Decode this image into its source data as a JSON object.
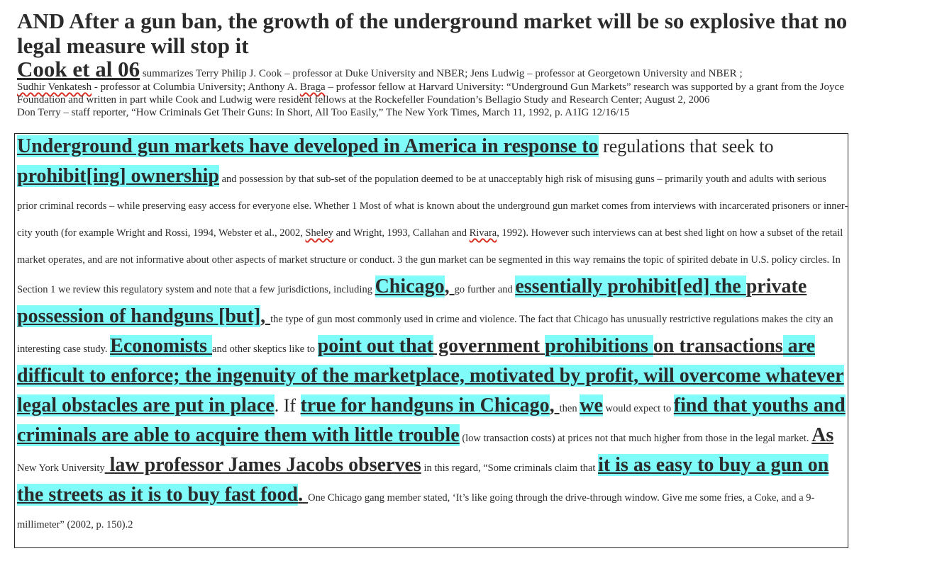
{
  "tag": "AND After a gun ban, the growth of the underground market will be so explosive that no legal measure will stop it",
  "cite": {
    "name": "Cook et al 06",
    "text1": " summarizes Terry Philip J. Cook – professor at Duke University and NBER; Jens Ludwig – professor at Georgetown University and NBER ; ",
    "sudhir": "Sudhir Venkatesh",
    "text2": " - professor at Columbia University; Anthony A. ",
    "braga": "Braga",
    "text3": " – professor fellow at Harvard University: “Underground Gun Markets” research was supported by a grant from the Joyce Foundation and written in part while Cook and Ludwig were resident fellows at the Rockefeller Foundation’s Bellagio Study and Research Center; August 2, 2006",
    "line4": "Don Terry – staff reporter, “How Criminals Get Their Guns: In Short, All Too Easily,” The New York Times, March 11, 1992, p. A1IG 12/16/15"
  },
  "card": {
    "s1": "Underground gun markets have developed in America in response to",
    "s2": " regulations that seek to ",
    "s3": "prohibit[ing] ownership",
    "s4": " and possession by that sub-set of the population deemed to be at unacceptably high risk of misusing guns – primarily youth and adults with serious prior criminal records – while preserving easy access for everyone else. Whether 1 Most of what is known about the underground gun market comes from interviews with incarcerated prisoners or inner-city youth (for example Wright and Rossi, 1994, Webster et al., 2002, ",
    "sheley": "Sheley",
    "s5": " and Wright, 1993, Callahan and ",
    "rivara": "Rivara",
    "s6": ", 1992). However such interviews can at best shed light on how a subset of the retail market operates, and are not informative about other aspects of market structure or conduct. 3 the gun market can be segmented in this way remains the topic of spirited debate in U.S. policy circles. In Section 1 we review this regulatory system and note that a few jurisdictions, including ",
    "s7": "Chicago",
    "s8": ", ",
    "s9": "go further and ",
    "s10": "essentially prohibit[ed] the ",
    "s11": "private",
    "s12": " possession of handguns [but]",
    "s13": ", ",
    "s14": "the type of gun most commonly used in crime and violence. The fact that Chicago has unusually restrictive regulations makes the city an interesting case study. ",
    "s15": "Economists ",
    "s16": "and other skeptics like to ",
    "s17": "point out that",
    "s18": " government ",
    "s19": "prohibitions ",
    "s20": "on transactions",
    "s21": " are difficult to enforce; the ingenuity ",
    "s22": "of the marketplace, motivated by profit, will overcome whatever legal obstacles are put in place",
    "s23": ". If ",
    "s24": "true for handguns in Chicago",
    "s25": ", ",
    "s26": "then ",
    "s27": "we",
    "s28": " would expect to ",
    "s29": "find that youths and criminals are able to acquire them with little trouble",
    "s30": " (low transaction costs) at prices not that much higher from those in the legal market. ",
    "s31": "As ",
    "s32": "New York University",
    "s33": " law professor James Jacobs observes",
    "s34": " in this regard, “Some criminals claim that ",
    "s35": "it is as easy to buy a gun on the streets as it is to buy fast food",
    "s36": ". ",
    "s37": "One Chicago gang member stated, ‘It’s like going through the drive-through window. Give me some fries, a Coke, and a 9-millimeter” (2002, p. 150).2"
  }
}
